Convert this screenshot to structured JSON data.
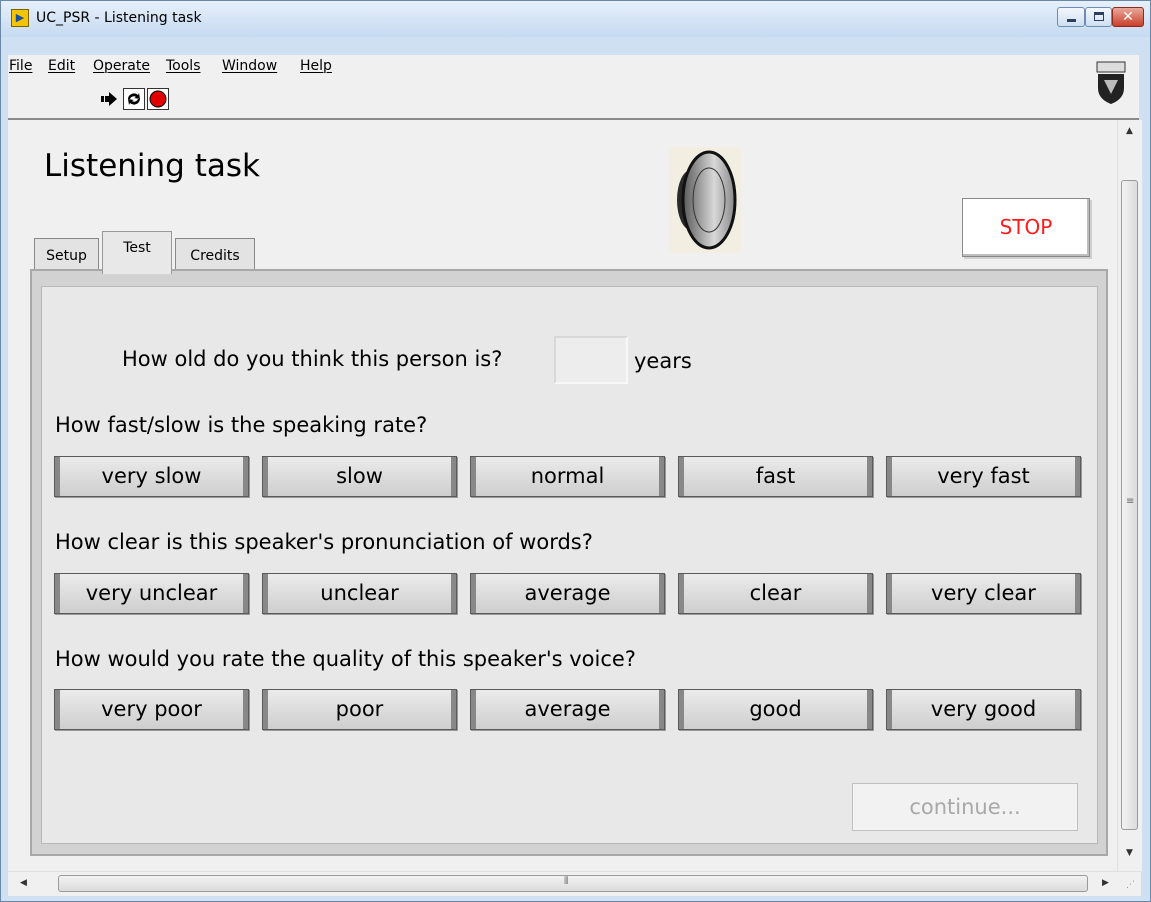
{
  "window": {
    "title": "UC_PSR - Listening task",
    "app_icon": "labview-icon"
  },
  "menu": [
    {
      "label": "File"
    },
    {
      "label": "Edit"
    },
    {
      "label": "Operate"
    },
    {
      "label": "Tools"
    },
    {
      "label": "Window"
    },
    {
      "label": "Help"
    }
  ],
  "toolbar": {
    "run": "run-arrow-icon",
    "run_continuous": "run-continuously-icon",
    "abort": "abort-icon"
  },
  "page": {
    "title": "Listening task",
    "stop_label": "STOP",
    "tabs": [
      {
        "label": "Setup"
      },
      {
        "label": "Test",
        "selected": true
      },
      {
        "label": "Credits"
      }
    ]
  },
  "test": {
    "age_question": "How old do you think this person is?",
    "age_value": "",
    "age_unit": "years",
    "rate": {
      "question": "How fast/slow is the speaking rate?",
      "options": [
        "very slow",
        "slow",
        "normal",
        "fast",
        "very fast"
      ]
    },
    "clarity": {
      "question": "How clear is this speaker's pronunciation of words?",
      "options": [
        "very unclear",
        "unclear",
        "average",
        "clear",
        "very clear"
      ]
    },
    "quality": {
      "question": "How would you rate the quality of this speaker's voice?",
      "options": [
        "very poor",
        "poor",
        "average",
        "good",
        "very good"
      ]
    },
    "continue_label": "continue...",
    "continue_enabled": false
  },
  "colors": {
    "stop_text": "#ff1a1a",
    "disabled_text": "#a8a8a8"
  }
}
